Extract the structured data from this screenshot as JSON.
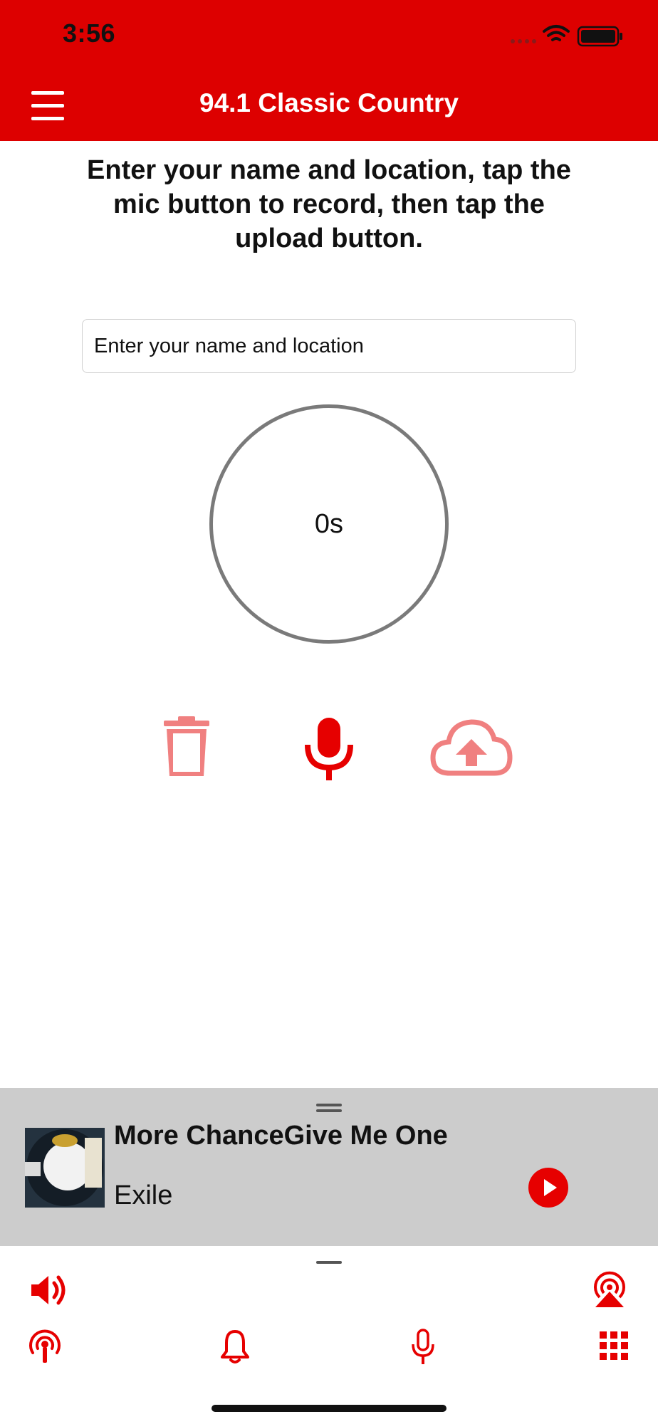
{
  "status_bar": {
    "time": "3:56"
  },
  "header": {
    "title": "94.1 Classic Country"
  },
  "instructions": "Enter your name and location, tap the mic button to record, then tap the upload button.",
  "name_input": {
    "placeholder": "Enter your name and location",
    "value": ""
  },
  "timer": {
    "label": "0s"
  },
  "actions": {
    "icons": [
      "trash-icon",
      "microphone-icon",
      "cloud-upload-icon"
    ]
  },
  "now_playing": {
    "title": "More ChanceGive Me One",
    "artist": "Exile"
  },
  "tab_icons": [
    "volume-icon",
    "airplay-icon",
    "podcast-icon",
    "bell-icon",
    "microphone-icon",
    "grid-icon"
  ],
  "colors": {
    "brand_red": "#dd0000",
    "accent_red": "#e60000",
    "muted_red": "#f08080",
    "player_bg": "#cccccc"
  }
}
